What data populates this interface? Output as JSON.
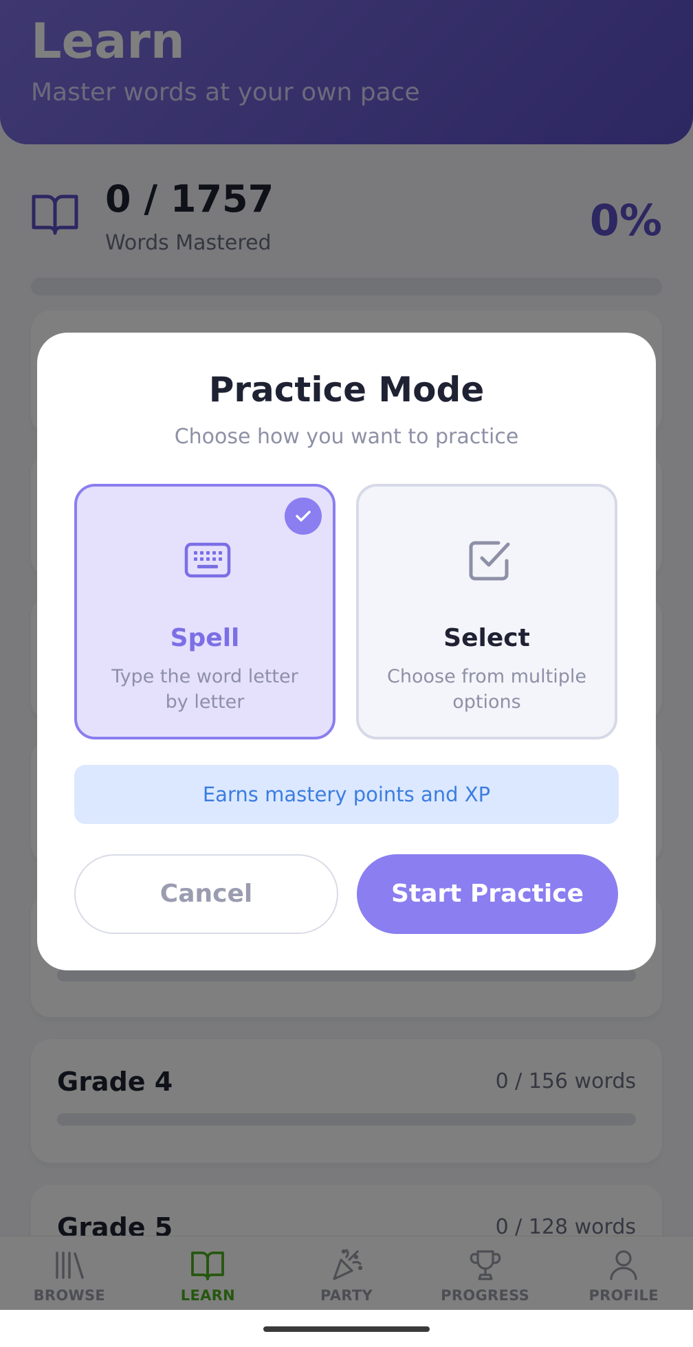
{
  "header": {
    "title": "Learn",
    "subtitle": "Master words at your own pace"
  },
  "summary": {
    "count": "0 / 1757",
    "label": "Words Mastered",
    "percent": "0%",
    "progress_fraction": 0
  },
  "grades": [
    {
      "name": "Grade 4",
      "count": "0 / 156 words",
      "progress_fraction": 0
    },
    {
      "name": "Grade 5",
      "count": "0 / 128 words",
      "progress_fraction": 0
    }
  ],
  "bottom_nav": {
    "items": [
      {
        "label": "BROWSE",
        "icon": "library-icon",
        "active": false
      },
      {
        "label": "LEARN",
        "icon": "open-book-icon",
        "active": true
      },
      {
        "label": "PARTY",
        "icon": "party-popper-icon",
        "active": false
      },
      {
        "label": "PROGRESS",
        "icon": "trophy-icon",
        "active": false
      },
      {
        "label": "PROFILE",
        "icon": "person-icon",
        "active": false
      }
    ],
    "active_color": "#4caf1e",
    "inactive_color": "#9a9ca8"
  },
  "modal": {
    "title": "Practice Mode",
    "subtitle": "Choose how you want to practice",
    "options": [
      {
        "title": "Spell",
        "description": "Type the word letter by letter",
        "icon": "keyboard-icon",
        "selected": true
      },
      {
        "title": "Select",
        "description": "Choose from multiple options",
        "icon": "checkbox-icon",
        "selected": false
      }
    ],
    "info": "Earns mastery points and XP",
    "cancel_label": "Cancel",
    "start_label": "Start Practice"
  },
  "colors": {
    "accent": "#8a7ef0",
    "header_start": "#7d70e0",
    "header_end": "#5b4fc4",
    "info_text": "#3b7de0",
    "info_bg": "#dce8ff"
  }
}
